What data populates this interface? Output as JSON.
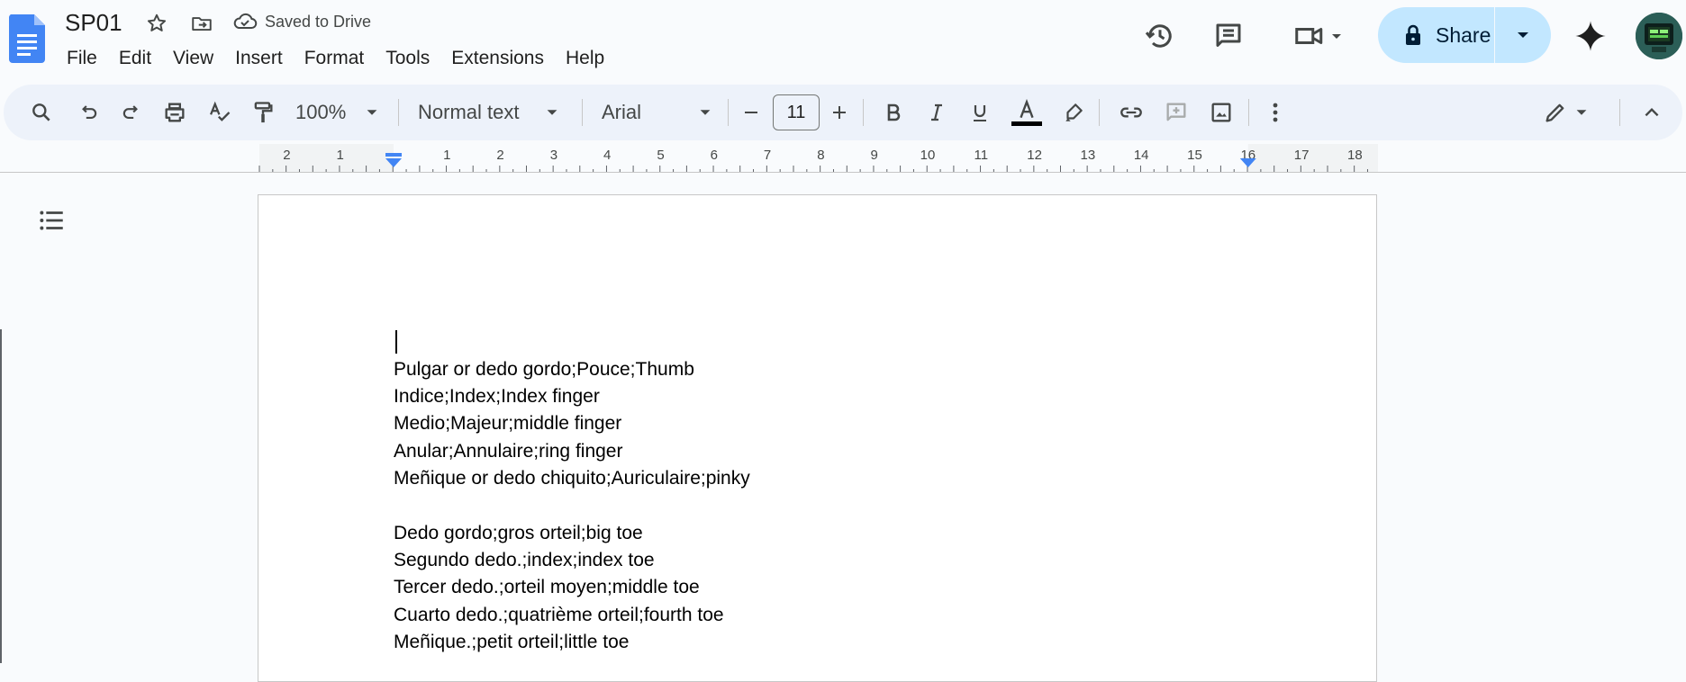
{
  "header": {
    "doc_title": "SP01",
    "save_status": "Saved to Drive",
    "menu": [
      "File",
      "Edit",
      "View",
      "Insert",
      "Format",
      "Tools",
      "Extensions",
      "Help"
    ],
    "share_label": "Share"
  },
  "toolbar": {
    "zoom": "100%",
    "style": "Normal text",
    "font": "Arial",
    "font_size": "11",
    "text_color": "#000000"
  },
  "ruler": {
    "labels": [
      "2",
      "1",
      "1",
      "2",
      "3",
      "4",
      "5",
      "6",
      "7",
      "8",
      "9",
      "10",
      "11",
      "12",
      "13",
      "14",
      "15",
      "16",
      "17",
      "18"
    ]
  },
  "document": {
    "lines": [
      "Pulgar or dedo gordo;Pouce;Thumb",
      "Indice;Index;Index finger",
      "Medio;Majeur;middle finger",
      "Anular;Annulaire;ring finger",
      "Meñique or dedo chiquito;Auriculaire;pinky",
      "",
      "Dedo gordo;gros orteil;big toe",
      "Segundo dedo.;index;index toe",
      "Tercer dedo.;orteil moyen;middle toe",
      "Cuarto dedo.;quatrième orteil;fourth toe",
      "Meñique.;petit orteil;little toe"
    ]
  },
  "colors": {
    "accent_blue": "#4285f4",
    "share_bg": "#c2e7ff",
    "toolbar_bg": "#edf2fa"
  }
}
